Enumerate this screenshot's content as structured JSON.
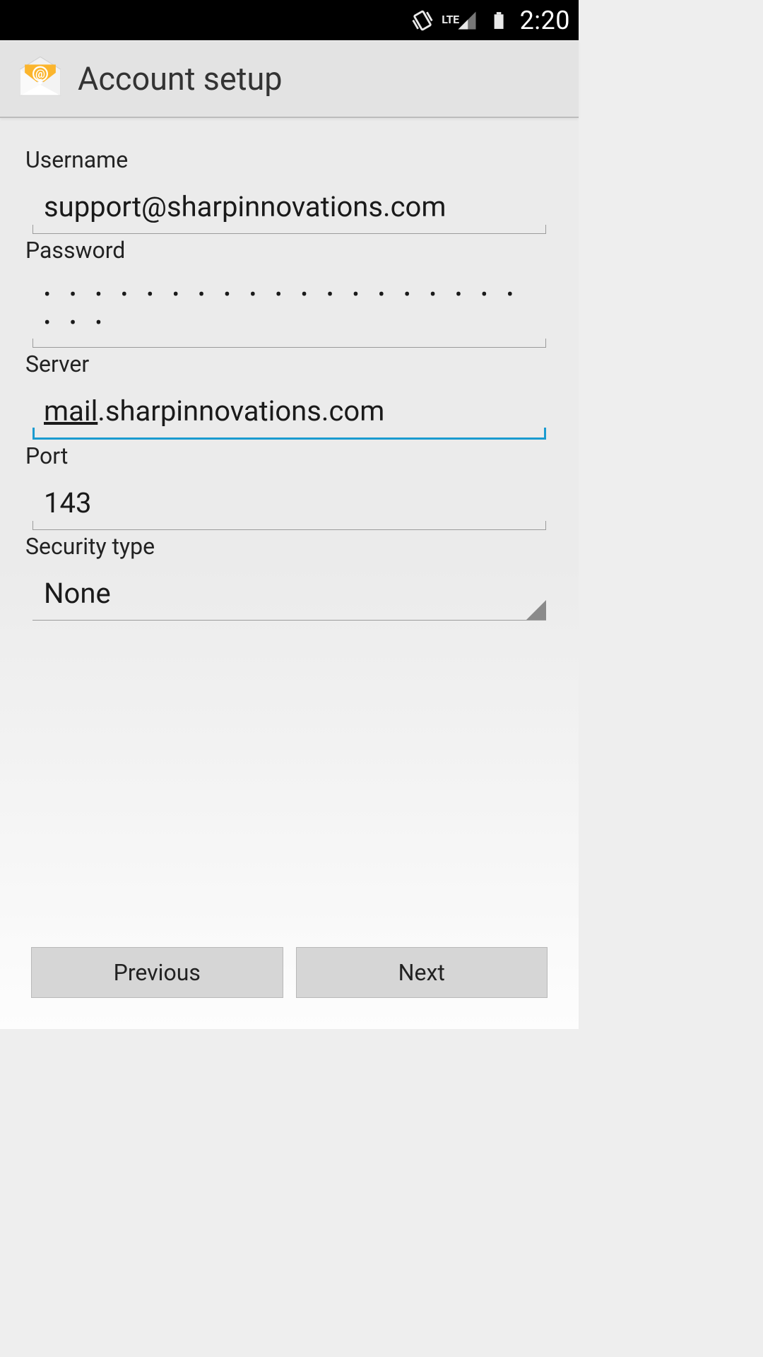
{
  "statusbar": {
    "network_label": "LTE",
    "time": "2:20"
  },
  "actionbar": {
    "title": "Account setup"
  },
  "form": {
    "username_label": "Username",
    "username_value": "support@sharpinnovations.com",
    "password_label": "Password",
    "password_value_masked": "• • • • • • • • • • • • • • • • • • • • • •",
    "server_label": "Server",
    "server_value_prefix": "mail",
    "server_value_suffix": ".sharpinnovations.com",
    "port_label": "Port",
    "port_value": "143",
    "security_label": "Security type",
    "security_value": "None"
  },
  "footer": {
    "prev": "Previous",
    "next": "Next"
  }
}
